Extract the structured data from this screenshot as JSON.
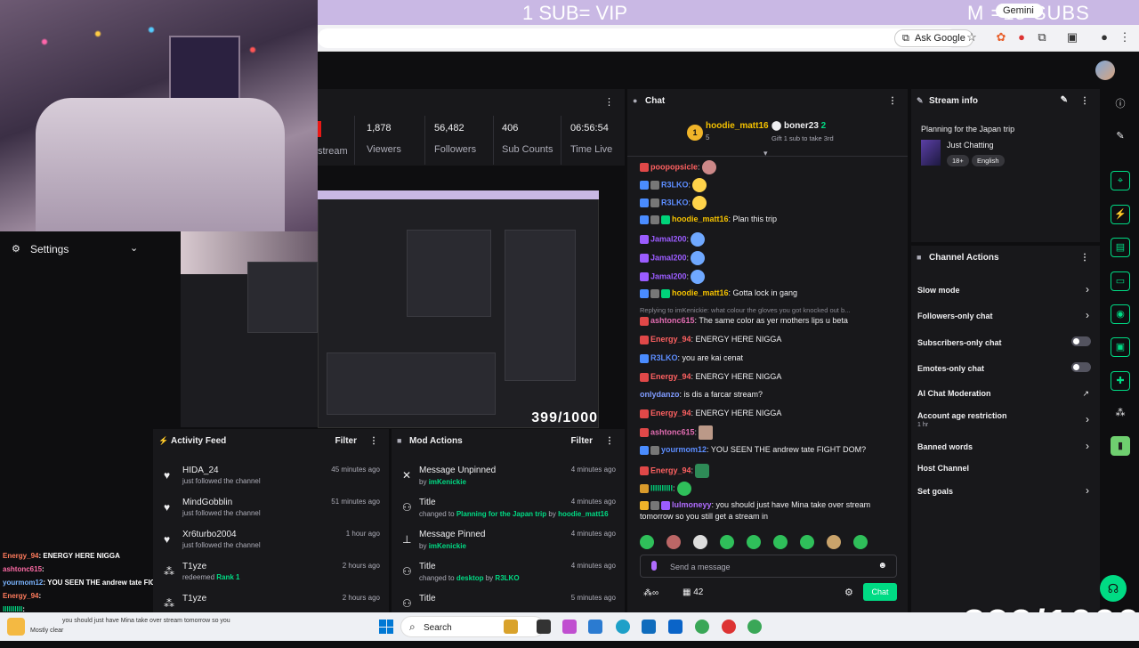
{
  "banner": {
    "left_text": "1 SUB= VIP",
    "right_text": "M    =15 SUBS",
    "pill": "Gemini"
  },
  "browser": {
    "ask_google": "Ask Google"
  },
  "stats": [
    {
      "value": "1,878",
      "label": "Viewers"
    },
    {
      "value": "56,482",
      "label": "Followers"
    },
    {
      "value": "406",
      "label": "Sub Counts"
    },
    {
      "value": "06:56:54",
      "label": "Time Live"
    }
  ],
  "stats_partial_label": "stream",
  "preview": {
    "count": "399/1000"
  },
  "settings": {
    "label": "Settings"
  },
  "overlay_chat": [
    {
      "user": "Energy_94",
      "text": ": ENERGY HERE NIGGA"
    },
    {
      "user": "ashtonc615",
      "text": ":"
    },
    {
      "user": "yourmom12",
      "text": ": YOU SEEN THE andrew tate FIGHT DOM?"
    },
    {
      "user": "Energy_94",
      "text": ":"
    },
    {
      "user": "IIIIIIIIII",
      "text": ":"
    }
  ],
  "activity": {
    "title": "Activity Feed",
    "filter": "Filter",
    "items": [
      {
        "name": "HIDA_24",
        "sub": "just followed the channel",
        "time": "45 minutes ago"
      },
      {
        "name": "MindGobblin",
        "sub": "just followed the channel",
        "time": "51 minutes ago"
      },
      {
        "name": "Xr6turbo2004",
        "sub": "just followed the channel",
        "time": "1 hour ago"
      },
      {
        "name": "T1yze",
        "sub_prefix": "redeemed",
        "sub_hl": "Rank 1",
        "time": "2 hours ago"
      },
      {
        "name": "T1yze",
        "sub": "",
        "time": "2 hours ago"
      }
    ]
  },
  "mod": {
    "title": "Mod Actions",
    "filter": "Filter",
    "items": [
      {
        "name": "Message Unpinned",
        "pre": "by",
        "hl1": "imKenickie",
        "mid": "",
        "hl2": "",
        "time": "4 minutes ago"
      },
      {
        "name": "Title",
        "pre": "changed to",
        "hl1": "Planning for the Japan trip",
        "mid": "by",
        "hl2": "hoodie_matt16",
        "time": "4 minutes ago"
      },
      {
        "name": "Message Pinned",
        "pre": "by",
        "hl1": "imKenickie",
        "mid": "",
        "hl2": "",
        "time": "4 minutes ago"
      },
      {
        "name": "Title",
        "pre": "changed to",
        "hl1": "desktop",
        "mid": "by",
        "hl2": "R3LKO",
        "time": "4 minutes ago"
      },
      {
        "name": "Title",
        "pre": "",
        "hl1": "",
        "mid": "",
        "hl2": "",
        "time": "5 minutes ago"
      }
    ]
  },
  "chat": {
    "title": "Chat",
    "top_gifter": {
      "rank": "1",
      "name": "hoodie_matt16",
      "count": "5"
    },
    "second": {
      "name": "boner23",
      "count": "2",
      "note": "Gift 1 sub to take 3rd"
    },
    "messages": [
      {
        "user": "poopopsicle",
        "text": ":"
      },
      {
        "user": "R3LKO",
        "text": ":"
      },
      {
        "user": "R3LKO",
        "text": ":"
      },
      {
        "user": "hoodie_matt16",
        "text": ": Plan this trip"
      },
      {
        "user": "Jamal200",
        "text": ":"
      },
      {
        "user": "Jamal200",
        "text": ":"
      },
      {
        "user": "Jamal200",
        "text": ":"
      },
      {
        "user": "hoodie_matt16",
        "text": ": Gotta lock in gang"
      },
      {
        "user": "ashtonc615",
        "text": ": The same color as yer mothers lips u beta"
      },
      {
        "user": "Energy_94",
        "text": ": ENERGY HERE NIGGA"
      },
      {
        "user": "R3LKO",
        "text": ": you are kai cenat"
      },
      {
        "user": "Energy_94",
        "text": ": ENERGY HERE NIGGA"
      },
      {
        "user": "onlydanzo",
        "text": ": is dis a farcar stream?"
      },
      {
        "user": "Energy_94",
        "text": ": ENERGY HERE NIGGA"
      },
      {
        "user": "ashtonc615",
        "text": ":"
      },
      {
        "user": "yourmom12",
        "text": ": YOU SEEN THE andrew tate FIGHT DOM?"
      },
      {
        "user": "Energy_94",
        "text": ":"
      },
      {
        "user": "IIIIIIIIII",
        "text": ":"
      },
      {
        "user": "lulmoneyy",
        "text": ": you should just have Mina take over stream"
      }
    ],
    "reply_line": "Replying to imKenickie: what colour the gloves you got knocked out b...",
    "wrap_line": "tomorrow so you still get a stream in",
    "placeholder": "Send a message",
    "viewer_count": "42",
    "chat_button": "Chat"
  },
  "stream_info": {
    "title": "Stream info",
    "stream_title": "Planning for the Japan trip",
    "category": "Just Chatting",
    "tags": [
      "18+",
      "English"
    ]
  },
  "channel_actions": {
    "title": "Channel Actions",
    "items": [
      {
        "label": "Slow mode",
        "kind": "chevron"
      },
      {
        "label": "Followers-only chat",
        "kind": "chevron"
      },
      {
        "label": "Subscribers-only chat",
        "kind": "toggle"
      },
      {
        "label": "Emotes-only chat",
        "kind": "toggle"
      },
      {
        "label": "AI Chat Moderation",
        "kind": "external"
      },
      {
        "label": "Account age restriction",
        "sub": "1 hr",
        "kind": "chevron"
      },
      {
        "label": "Banned words",
        "kind": "chevron"
      },
      {
        "label": "Host Channel",
        "kind": "none"
      },
      {
        "label": "Set goals",
        "kind": "chevron"
      }
    ]
  },
  "big_counter": "399/1000",
  "taskbar": {
    "search": "Search",
    "note": "you should just have Mina take over stream tomorrow so you",
    "weather": "Mostly clear"
  }
}
